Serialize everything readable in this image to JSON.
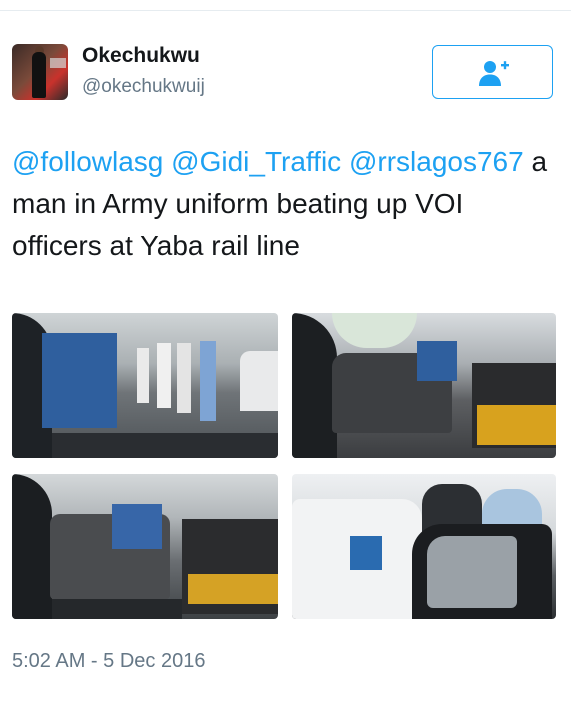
{
  "author": {
    "display_name": "Okechukwu",
    "handle": "@okechukwuij",
    "avatar_icon": "profile-photo"
  },
  "follow_button": {
    "icon": "follow-user-plus-icon",
    "color": "#1da1f2"
  },
  "tweet": {
    "mention1": "@followlasg",
    "mention2": "@Gidi_Traffic",
    "mention3": "@rrslagos767",
    "body_text": "a man in Army uniform beating up VOI officers at Yaba rail line",
    "photo_count": 4,
    "timestamp": "5:02 AM - 5 Dec 2016"
  },
  "colors": {
    "link": "#1da1f2",
    "secondary_text": "#657786",
    "primary_text": "#14171a"
  }
}
